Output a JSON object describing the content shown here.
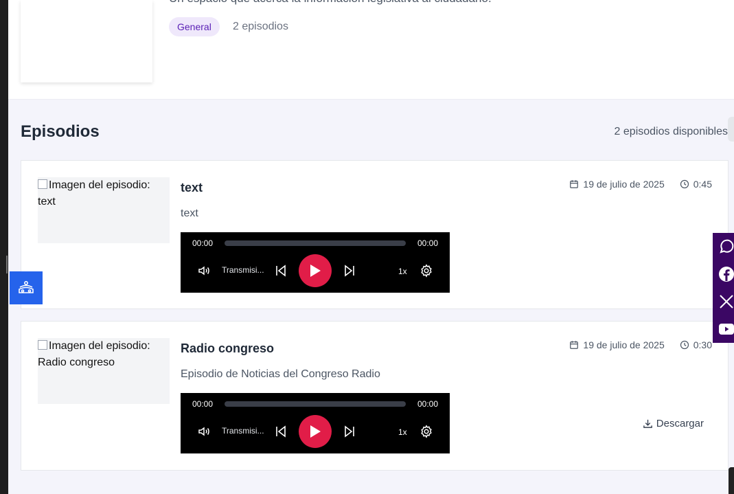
{
  "podcast": {
    "description": "Un espacio que acerca la información legislativa al ciudadano.",
    "category": "General",
    "episode_count": "2 episodios"
  },
  "episodes_section": {
    "title": "Episodios",
    "available": "2 episodios disponibles"
  },
  "episodes": [
    {
      "image_alt": "Imagen del episodio: text",
      "title": "text",
      "description": "text",
      "date": "19 de julio de 2025",
      "duration": "0:45",
      "player": {
        "current": "00:00",
        "total": "00:00",
        "label": "Transmisi...",
        "speed": "1x"
      }
    },
    {
      "image_alt": "Imagen del episodio: Radio congreso",
      "title": "Radio congreso",
      "description": "Episodio de Noticias del Congreso Radio",
      "date": "19 de julio de 2025",
      "duration": "0:30",
      "player": {
        "current": "00:00",
        "total": "00:00",
        "label": "Transmisi...",
        "speed": "1x"
      },
      "download_label": "Descargar"
    }
  ],
  "social_icons": [
    "whatsapp-icon",
    "facebook-icon",
    "x-icon",
    "youtube-icon"
  ],
  "colors": {
    "play": "#e11d48",
    "badge_bg": "#efe8fb",
    "badge_text": "#5b21b6",
    "social_bg": "#3b0764",
    "accessibility": "#2563eb"
  }
}
